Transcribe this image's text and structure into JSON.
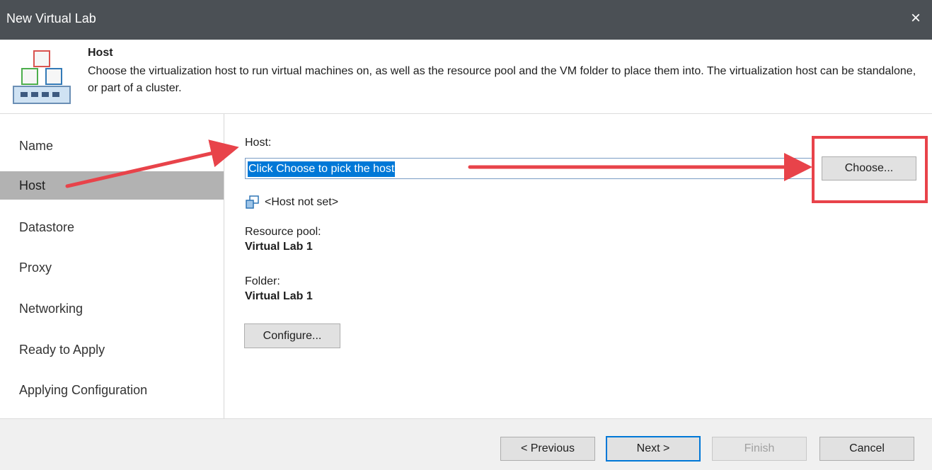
{
  "window": {
    "title": "New Virtual Lab",
    "close_icon": "×"
  },
  "header": {
    "title": "Host",
    "description": "Choose the virtualization host to run virtual machines on, as well as the resource pool and the VM folder to place them into. The virtualization host can be standalone, or part of a cluster."
  },
  "nav": {
    "items": [
      {
        "label": "Name"
      },
      {
        "label": "Host"
      },
      {
        "label": "Datastore"
      },
      {
        "label": "Proxy"
      },
      {
        "label": "Networking"
      },
      {
        "label": "Ready to Apply"
      },
      {
        "label": "Applying Configuration"
      }
    ],
    "active": "Host"
  },
  "content": {
    "host_label": "Host:",
    "host_value": "Click Choose to pick the host",
    "choose_button": "Choose...",
    "host_status": "<Host not set>",
    "resource_pool_label": "Resource pool:",
    "resource_pool_value": "Virtual Lab 1",
    "folder_label": "Folder:",
    "folder_value": "Virtual Lab 1",
    "configure_button": "Configure..."
  },
  "footer": {
    "previous": "< Previous",
    "next": "Next >",
    "finish": "Finish",
    "cancel": "Cancel"
  },
  "colors": {
    "accent": "#0078d7",
    "annotation": "#e8434a",
    "titlebar": "#4b5055"
  }
}
